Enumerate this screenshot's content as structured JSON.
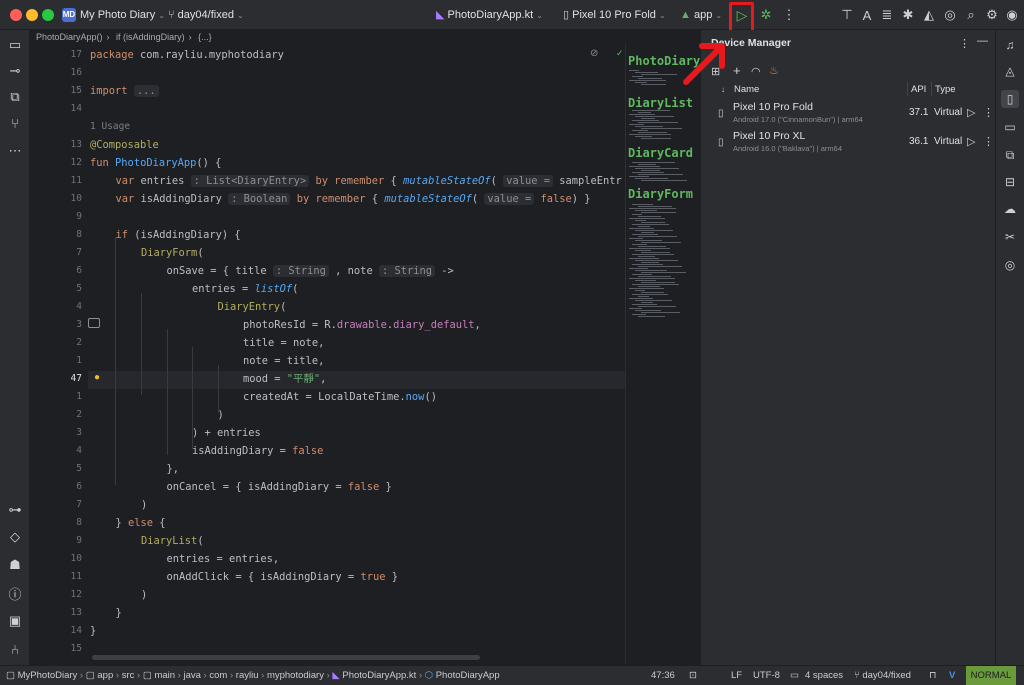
{
  "titlebar": {
    "project_badge": "MD",
    "project": "My Photo Diary",
    "branch": "day04/fixed",
    "file": "PhotoDiaryApp.kt",
    "device": "Pixel 10 Pro Fold",
    "config": "app"
  },
  "breadcrumb": [
    "PhotoDiaryApp()",
    "if (isAddingDiary)",
    "{...}"
  ],
  "code_lines": [
    {
      "n": "17",
      "t": "package com.rayliu.myphotodiary"
    },
    {
      "n": "16",
      "t": ""
    },
    {
      "n": "15",
      "t": "import ..."
    },
    {
      "n": "14",
      "t": ""
    },
    {
      "n": "",
      "t": "1 Usage"
    },
    {
      "n": "13",
      "t": "@Composable"
    },
    {
      "n": "12",
      "t": "fun PhotoDiaryApp() {"
    },
    {
      "n": "11",
      "t": "var entries : List<DiaryEntry> by remember { mutableStateOf( value = sampleEntr"
    },
    {
      "n": "10",
      "t": "var isAddingDiary : Boolean by remember { mutableStateOf( value = false) }"
    },
    {
      "n": "9",
      "t": ""
    },
    {
      "n": "8",
      "t": "if (isAddingDiary) {"
    },
    {
      "n": "7",
      "t": "DiaryForm("
    },
    {
      "n": "6",
      "t": "onSave = { title : String , note : String ->"
    },
    {
      "n": "5",
      "t": "entries = listOf("
    },
    {
      "n": "4",
      "t": "DiaryEntry("
    },
    {
      "n": "3",
      "t": "photoResId = R.drawable.diary_default,"
    },
    {
      "n": "2",
      "t": "title = note,"
    },
    {
      "n": "1",
      "t": "note = title,"
    },
    {
      "n": "47",
      "t": "mood = \"平靜\","
    },
    {
      "n": "1",
      "t": "createdAt = LocalDateTime.now()"
    },
    {
      "n": "2",
      "t": ")"
    },
    {
      "n": "3",
      "t": ") + entries"
    },
    {
      "n": "4",
      "t": "isAddingDiary = false"
    },
    {
      "n": "5",
      "t": "},"
    },
    {
      "n": "6",
      "t": "onCancel = { isAddingDiary = false }"
    },
    {
      "n": "7",
      "t": ")"
    },
    {
      "n": "8",
      "t": "} else {"
    },
    {
      "n": "9",
      "t": "DiaryList("
    },
    {
      "n": "10",
      "t": "entries = entries,"
    },
    {
      "n": "11",
      "t": "onAddClick = { isAddingDiary = true }"
    },
    {
      "n": "12",
      "t": ")"
    },
    {
      "n": "13",
      "t": "}"
    },
    {
      "n": "14",
      "t": "}"
    },
    {
      "n": "15",
      "t": ""
    }
  ],
  "minimap": {
    "titles": [
      "PhotoDiary",
      "DiaryList",
      "DiaryCard",
      "DiaryForm"
    ]
  },
  "device_manager": {
    "title": "Device Manager",
    "columns": {
      "name": "Name",
      "api": "API",
      "type": "Type"
    },
    "devices": [
      {
        "name": "Pixel 10 Pro Fold",
        "sub": "Android 17.0 (\"CinnamonBun\") | arm64",
        "api": "37.1",
        "type": "Virtual"
      },
      {
        "name": "Pixel 10 Pro XL",
        "sub": "Android 16.0 (\"Baklava\") | arm64",
        "api": "36.1",
        "type": "Virtual"
      }
    ]
  },
  "statusbar": {
    "path": [
      "MyPhotoDiary",
      "app",
      "src",
      "main",
      "java",
      "com",
      "rayliu",
      "myphotodiary",
      "PhotoDiaryApp.kt",
      "PhotoDiaryApp"
    ],
    "position": "47:36",
    "line_sep": "LF",
    "encoding": "UTF-8",
    "indent": "4 spaces",
    "branch": "day04/fixed",
    "mode": "NORMAL"
  },
  "colors": {
    "accent": "#4a6fd0",
    "highlight": "#e8191c",
    "mode_bg": "#6a9a3c"
  }
}
